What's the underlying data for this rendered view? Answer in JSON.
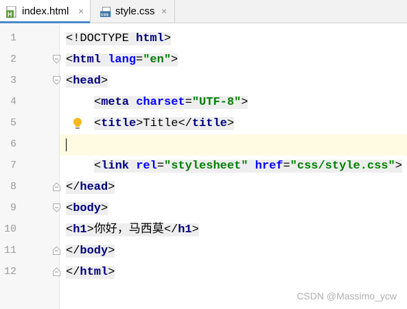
{
  "tabs": [
    {
      "label": "index.html",
      "icon": "html-file-icon",
      "close": "×",
      "active": true
    },
    {
      "label": "style.css",
      "icon": "css-file-icon",
      "close": "×",
      "active": false
    }
  ],
  "icon_text": {
    "html": "H",
    "css": "css"
  },
  "lines": [
    {
      "num": "1"
    },
    {
      "num": "2"
    },
    {
      "num": "3"
    },
    {
      "num": "4"
    },
    {
      "num": "5"
    },
    {
      "num": "6"
    },
    {
      "num": "7"
    },
    {
      "num": "8"
    },
    {
      "num": "9"
    },
    {
      "num": "10"
    },
    {
      "num": "11"
    },
    {
      "num": "12"
    }
  ],
  "code": {
    "l1": {
      "open": "<!DOCTYPE ",
      "kw": "html",
      "close": ">"
    },
    "l2": {
      "lt": "<",
      "tag": "html",
      "sp": " ",
      "attr": "lang",
      "eq": "=",
      "val": "\"en\"",
      "gt": ">"
    },
    "l3": {
      "lt": "<",
      "tag": "head",
      "gt": ">"
    },
    "l4": {
      "lt": "<",
      "tag": "meta",
      "sp": " ",
      "attr": "charset",
      "eq": "=",
      "val": "\"UTF-8\"",
      "gt": ">"
    },
    "l5": {
      "lt": "<",
      "tag": "title",
      "gt": ">",
      "text": "Title",
      "lt2": "</",
      "tag2": "title",
      "gt2": ">"
    },
    "l7": {
      "lt": "<",
      "tag": "link",
      "sp": " ",
      "attr": "rel",
      "eq": "=",
      "val": "\"stylesheet\"",
      "sp2": " ",
      "attr2": "href",
      "eq2": "=",
      "val2": "\"css/style.css\"",
      "gt": ">"
    },
    "l8": {
      "lt": "</",
      "tag": "head",
      "gt": ">"
    },
    "l9": {
      "lt": "<",
      "tag": "body",
      "gt": ">"
    },
    "l10": {
      "lt": "<",
      "tag": "h1",
      "gt": ">",
      "text": "你好，马西莫",
      "lt2": "</",
      "tag2": "h1",
      "gt2": ">"
    },
    "l11": {
      "lt": "</",
      "tag": "body",
      "gt": ">"
    },
    "l12": {
      "lt": "</",
      "tag": "html",
      "gt": ">"
    }
  },
  "watermark": "CSDN @Massimo_ycw",
  "colors": {
    "tag": "#000080",
    "attr": "#0000ff",
    "value": "#008000",
    "current_line": "#fffbe3",
    "tab_underline": "#4a88c7"
  }
}
